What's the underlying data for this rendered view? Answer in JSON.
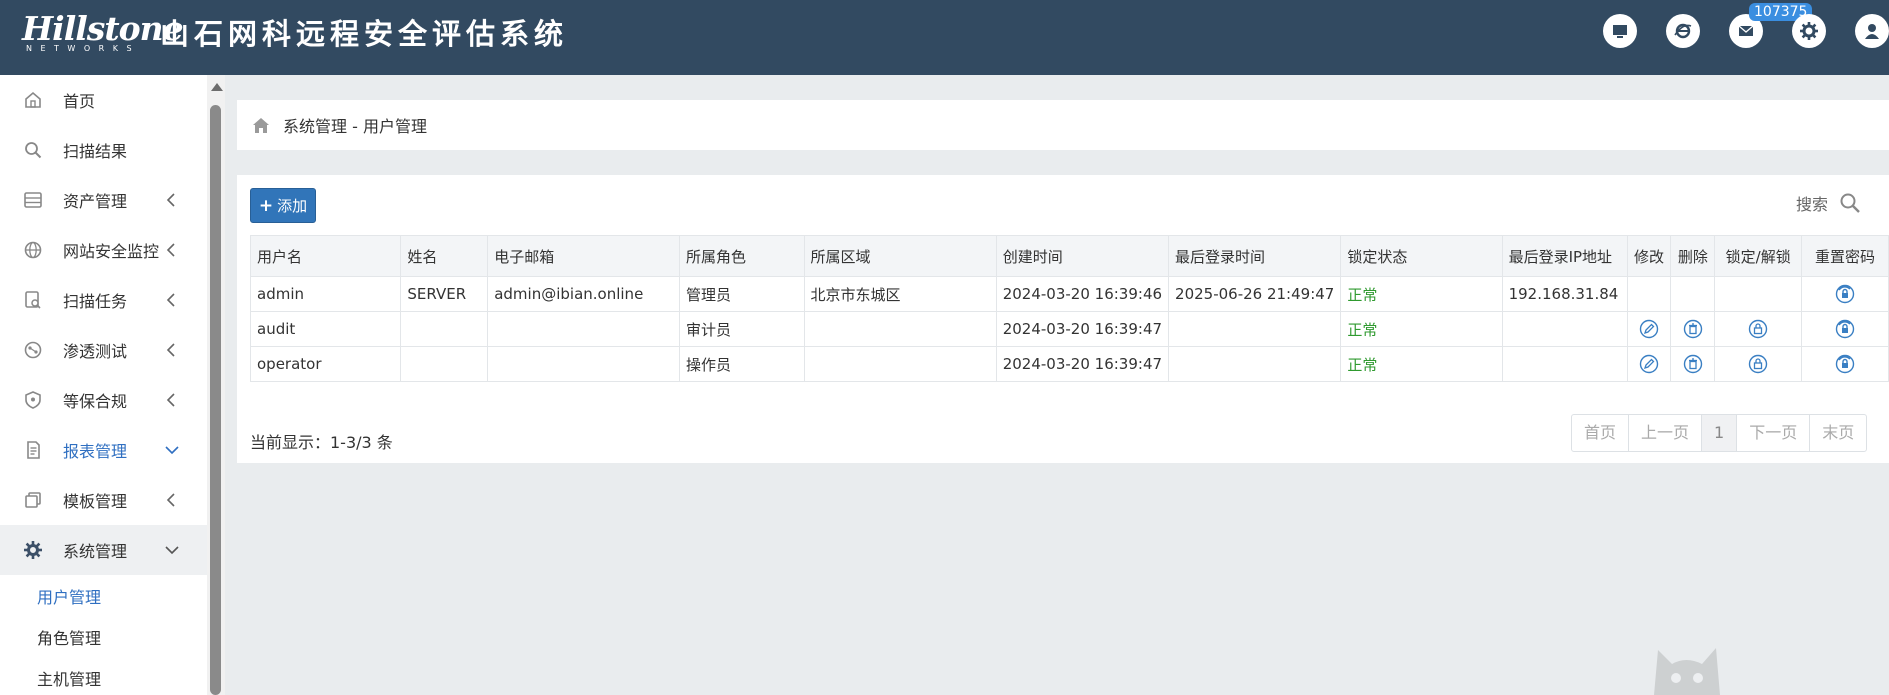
{
  "header": {
    "logo_text": "Hillstone",
    "logo_subtext": "NETWORKS",
    "title": "山石网科远程安全评估系统",
    "badge_count": "107375",
    "icons": [
      "monitor-icon",
      "browser-icon",
      "mail-icon",
      "gear-icon",
      "user-icon"
    ]
  },
  "sidebar": {
    "items": [
      {
        "label": "首页",
        "icon": "home-icon"
      },
      {
        "label": "扫描结果",
        "icon": "search-icon"
      },
      {
        "label": "资产管理",
        "icon": "server-icon"
      },
      {
        "label": "网站安全监控",
        "icon": "globe-icon"
      },
      {
        "label": "扫描任务",
        "icon": "scan-task-icon"
      },
      {
        "label": "渗透测试",
        "icon": "pentest-icon"
      },
      {
        "label": "等保合规",
        "icon": "shield-icon"
      },
      {
        "label": "报表管理",
        "icon": "report-icon"
      },
      {
        "label": "模板管理",
        "icon": "template-icon"
      },
      {
        "label": "系统管理",
        "icon": "gear-icon"
      }
    ],
    "subitems": [
      "用户管理",
      "角色管理",
      "主机管理"
    ]
  },
  "breadcrumb": {
    "text": "系统管理 - 用户管理"
  },
  "toolbar": {
    "add_label": "添加",
    "search_label": "搜索"
  },
  "table": {
    "headers": [
      "用户名",
      "姓名",
      "电子邮箱",
      "所属角色",
      "所属区域",
      "创建时间",
      "最后登录时间",
      "锁定状态",
      "最后登录IP地址",
      "修改",
      "删除",
      "锁定/解锁",
      "重置密码"
    ],
    "rows": [
      {
        "username": "admin",
        "name": "SERVER",
        "email": "admin@ibian.online",
        "role": "管理员",
        "region": "北京市东城区",
        "created": "2024-03-20 16:39:46",
        "last_login": "2025-06-26 21:49:47",
        "lock_status": "正常",
        "last_ip": "192.168.31.84"
      },
      {
        "username": "audit",
        "name": "",
        "email": "",
        "role": "审计员",
        "region": "",
        "created": "2024-03-20 16:39:47",
        "last_login": "",
        "lock_status": "正常",
        "last_ip": ""
      },
      {
        "username": "operator",
        "name": "",
        "email": "",
        "role": "操作员",
        "region": "",
        "created": "2024-03-20 16:39:47",
        "last_login": "",
        "lock_status": "正常",
        "last_ip": ""
      }
    ]
  },
  "pagination": {
    "info": "当前显示：1-3/3 条",
    "first": "首页",
    "prev": "上一页",
    "current": "1",
    "next": "下一页",
    "last": "末页"
  },
  "colors": {
    "header_bg": "#324a61",
    "accent": "#3175b9",
    "ok": "#2f9a2f",
    "active_menu": "#2f6fc1"
  }
}
